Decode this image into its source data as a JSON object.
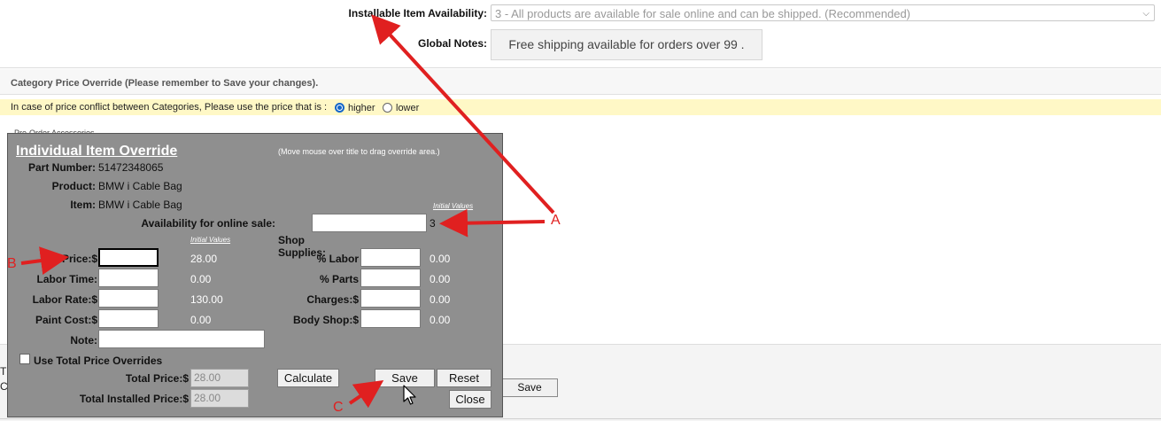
{
  "top": {
    "availability_label": "Installable Item Availability:",
    "availability_value": "3 - All products are available for sale online and can be shipped. (Recommended)",
    "notes_label": "Global Notes:",
    "notes_value": "Free shipping available for orders over 99 ."
  },
  "category": {
    "title": "Category Price Override (Please remember to Save your changes).",
    "conflict_text": "In case of price conflict between Categories, Please use the price that is :",
    "option_higher": "higher",
    "option_lower": "lower",
    "selected": "higher",
    "partial_text": "Pre-Order Accessories"
  },
  "background": {
    "save_label": "Save",
    "left_chars": [
      "T",
      "C"
    ]
  },
  "override": {
    "title": "Individual Item Override",
    "hint": "(Move mouse over title to drag override area.)",
    "part_number_label": "Part Number:",
    "part_number": "51472348065",
    "product_label": "Product:",
    "product": "BMW i Cable Bag",
    "item_label": "Item:",
    "item": "BMW i Cable Bag",
    "initial_values_label": "Initial Values",
    "availability_label": "Availability for online sale:",
    "availability_initial": "3",
    "shop_supplies_label": "Shop Supplies:",
    "price_label": "Price:$",
    "price_initial": "28.00",
    "labor_time_label": "Labor Time:",
    "labor_time_initial": "0.00",
    "labor_rate_label": "Labor Rate:$",
    "labor_rate_initial": "130.00",
    "paint_cost_label": "Paint Cost:$",
    "paint_cost_initial": "0.00",
    "note_label": "Note:",
    "pct_labor_label": "% Labor",
    "pct_labor_initial": "0.00",
    "pct_parts_label": "% Parts",
    "pct_parts_initial": "0.00",
    "charges_label": "Charges:$",
    "charges_initial": "0.00",
    "body_shop_label": "Body Shop:$",
    "body_shop_initial": "0.00",
    "use_total_label": "Use Total Price Overrides",
    "total_price_label": "Total Price:$",
    "total_price_value": "28.00",
    "total_installed_label": "Total Installed Price:$",
    "total_installed_value": "28.00",
    "calculate_label": "Calculate",
    "save_label": "Save",
    "reset_label": "Reset",
    "close_label": "Close"
  },
  "annotations": {
    "a": "A",
    "b": "B",
    "c": "C",
    "color": "#e02020"
  }
}
